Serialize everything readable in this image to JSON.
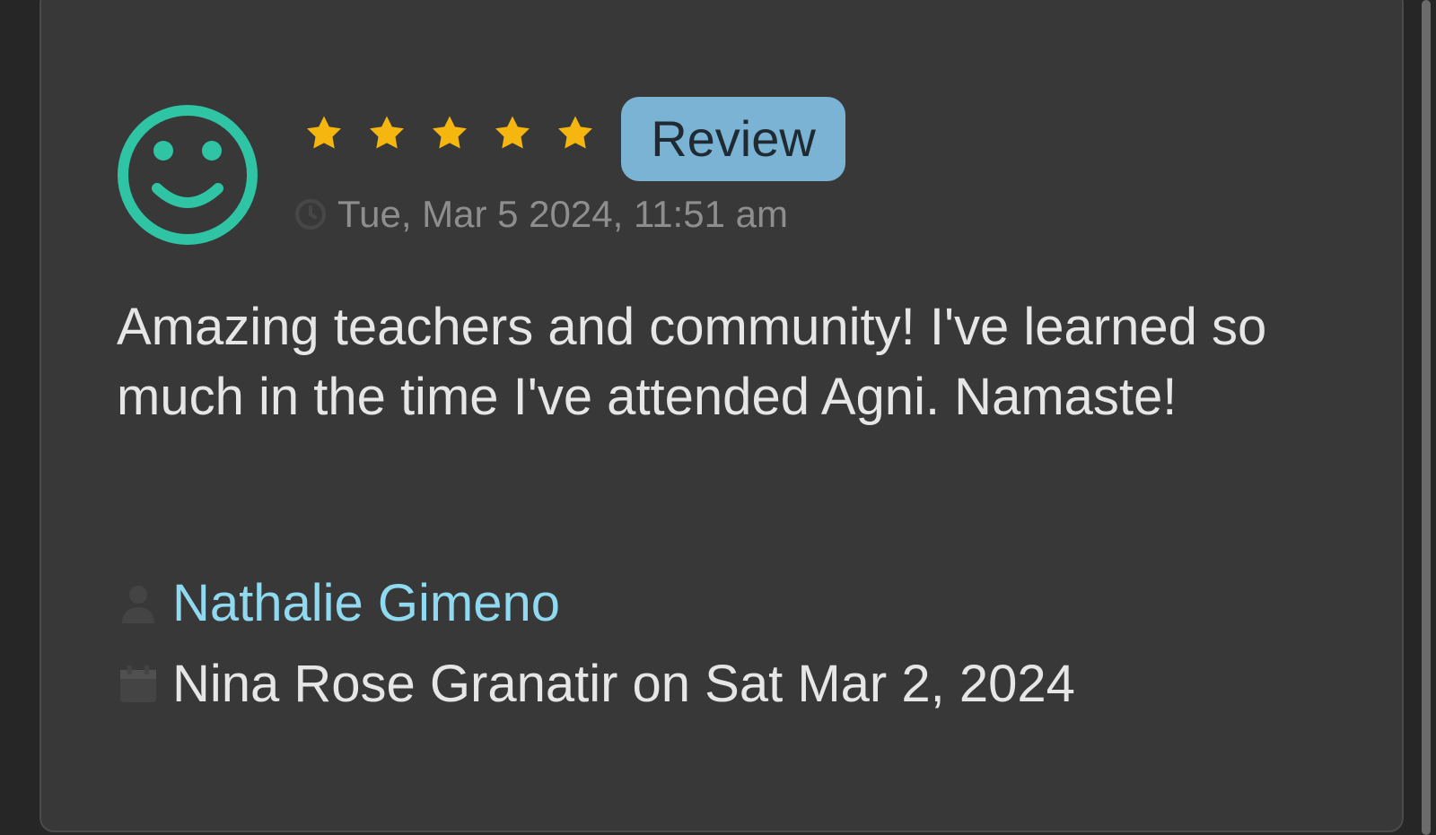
{
  "review_card": {
    "avatar_icon": "smiley-face-icon",
    "rating": 5,
    "rating_max": 5,
    "star_icon": "star-icon",
    "star_color": "#f5b70f",
    "accent_color": "#2ec4a4",
    "badge_label": "Review",
    "badge_color": "#7ab3d3",
    "timestamp_icon": "clock-icon",
    "timestamp": "Tue, Mar 5 2024, 11:51 am",
    "body": "Amazing teachers and community! I've learned so much in the time I've attended Agni. Namaste!",
    "author_icon": "person-icon",
    "author": "Nathalie Gimeno",
    "author_color": "#8fdaf0",
    "meta_icon": "calendar-icon",
    "meta": "Nina Rose Granatir on Sat Mar 2, 2024"
  }
}
